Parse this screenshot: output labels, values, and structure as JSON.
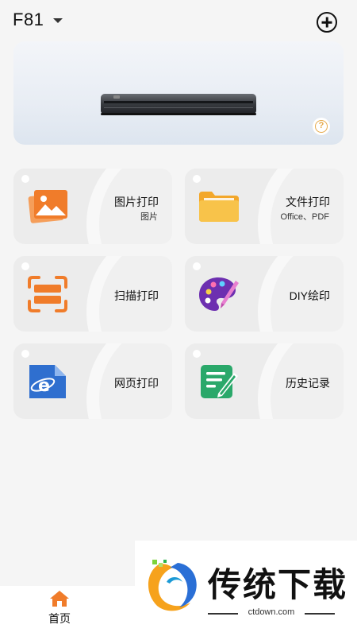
{
  "header": {
    "device_name": "F81"
  },
  "cards": [
    {
      "label": "图片打印",
      "sub": "图片",
      "icon": "image-icon"
    },
    {
      "label": "文件打印",
      "sub": "Office、PDF",
      "icon": "folder-icon"
    },
    {
      "label": "扫描打印",
      "sub": "",
      "icon": "scan-icon"
    },
    {
      "label": "DIY绘印",
      "sub": "",
      "icon": "palette-icon"
    },
    {
      "label": "网页打印",
      "sub": "",
      "icon": "browser-icon"
    },
    {
      "label": "历史记录",
      "sub": "",
      "icon": "history-icon"
    }
  ],
  "nav": {
    "home_label": "首页"
  },
  "watermark": {
    "title": "传统下载",
    "url": "ctdown.com"
  },
  "colors": {
    "accent": "#f07c2a",
    "folder": "#f6b73c",
    "palette": "#6d2fb0",
    "browser": "#2f6fcf",
    "history": "#2aa86a"
  }
}
